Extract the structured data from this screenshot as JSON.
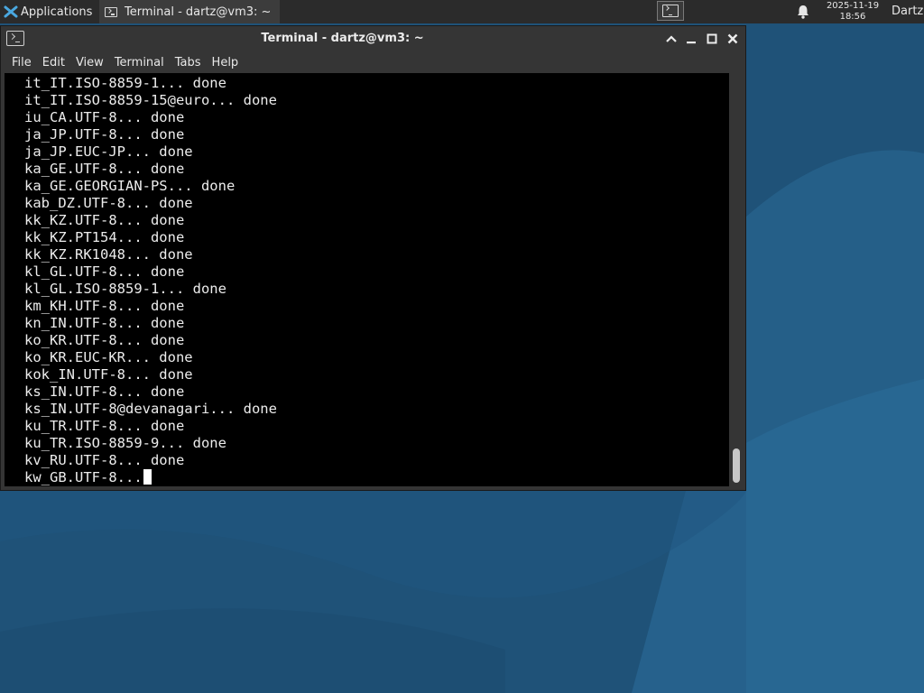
{
  "panel": {
    "applications_label": "Applications",
    "taskbar_terminal_label": "Terminal - dartz@vm3: ~",
    "clock_date": "2025-11-19",
    "clock_time": "18:56",
    "user_name": "Dartz"
  },
  "window": {
    "title": "Terminal - dartz@vm3: ~",
    "menu": [
      "File",
      "Edit",
      "View",
      "Terminal",
      "Tabs",
      "Help"
    ]
  },
  "terminal": {
    "lines": [
      "it_IT.ISO-8859-1... done",
      "it_IT.ISO-8859-15@euro... done",
      "iu_CA.UTF-8... done",
      "ja_JP.UTF-8... done",
      "ja_JP.EUC-JP... done",
      "ka_GE.UTF-8... done",
      "ka_GE.GEORGIAN-PS... done",
      "kab_DZ.UTF-8... done",
      "kk_KZ.UTF-8... done",
      "kk_KZ.PT154... done",
      "kk_KZ.RK1048... done",
      "kl_GL.UTF-8... done",
      "kl_GL.ISO-8859-1... done",
      "km_KH.UTF-8... done",
      "kn_IN.UTF-8... done",
      "ko_KR.UTF-8... done",
      "ko_KR.EUC-KR... done",
      "kok_IN.UTF-8... done",
      "ks_IN.UTF-8... done",
      "ks_IN.UTF-8@devanagari... done",
      "ku_TR.UTF-8... done",
      "ku_TR.ISO-8859-9... done",
      "kv_RU.UTF-8... done",
      "kw_GB.UTF-8..."
    ]
  },
  "colors": {
    "desktop_base": "#1f5278",
    "panel_bg": "#2b2b2b",
    "window_bg": "#353535",
    "terminal_bg": "#000000",
    "terminal_fg": "#ececec"
  },
  "icons": {
    "app_menu": "xfce-logo-icon",
    "terminal": "terminal-icon",
    "notifications": "bell-icon",
    "window_controls": [
      "chevron-up-icon",
      "minimize-icon",
      "maximize-icon",
      "close-icon"
    ]
  }
}
